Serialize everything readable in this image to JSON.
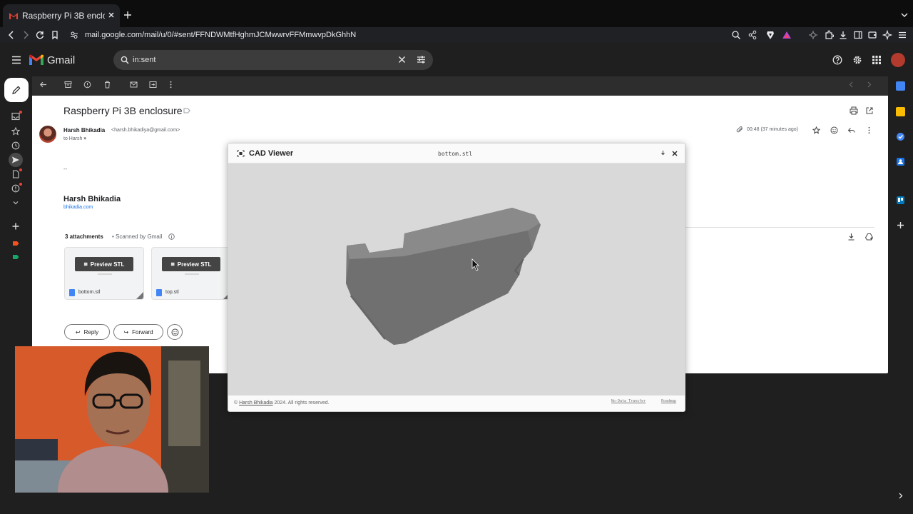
{
  "browser": {
    "tab_title": "Raspberry Pi 3B enclosure",
    "url": "mail.google.com/mail/u/0/#sent/FFNDWMtfHghmJCMwwrvFFMmwvpDkGhhN"
  },
  "gmail": {
    "app_name": "Gmail",
    "search_value": "in:sent",
    "accent": "#ea4335"
  },
  "email": {
    "subject": "Raspberry Pi 3B enclosure",
    "sender_name": "Harsh Bhikadia",
    "sender_email": "<harsh.bhikadiya@gmail.com>",
    "to_line": "to Harsh",
    "time": "00:48 (37 minutes ago)",
    "body_dash": "--",
    "signature_name": "Harsh Bhikadia",
    "signature_link": "bhikadia.com"
  },
  "attachments": {
    "count_label": "3 attachments",
    "scan_label": "• Scanned by Gmail",
    "preview_label": "Preview STL",
    "files": [
      "bottom.stl",
      "top.stl"
    ]
  },
  "replies": {
    "reply_label": "Reply",
    "forward_label": "Forward"
  },
  "cad_viewer": {
    "title": "CAD Viewer",
    "file": "bottom.stl",
    "copyright_prefix": "© ",
    "copyright_link": "Harsh Bhikadia",
    "copyright_suffix": " 2024. All rights reserved.",
    "no_data_link": "No-Data Transfer",
    "roadmap_link": "Roadmap",
    "model_color": "#7b7b7b",
    "background_color": "#d9d9d9"
  }
}
